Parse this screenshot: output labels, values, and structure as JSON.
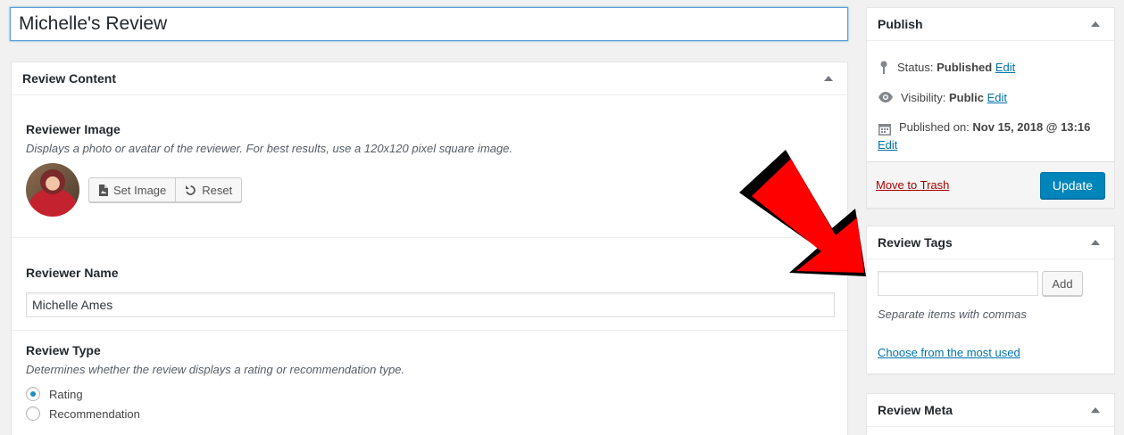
{
  "title": {
    "value": "Michelle's Review"
  },
  "review_content": {
    "heading": "Review Content",
    "reviewer_image": {
      "label": "Reviewer Image",
      "description": "Displays a photo or avatar of the reviewer. For best results, use a 120x120 pixel square image.",
      "set_image_label": "Set Image",
      "reset_label": "Reset"
    },
    "reviewer_name": {
      "label": "Reviewer Name",
      "value": "Michelle Ames"
    },
    "review_type": {
      "label": "Review Type",
      "description": "Determines whether the review displays a rating or recommendation type.",
      "options": [
        "Rating",
        "Recommendation"
      ],
      "selected": "Rating"
    }
  },
  "publish": {
    "heading": "Publish",
    "status_label": "Status:",
    "status_value": "Published",
    "visibility_label": "Visibility:",
    "visibility_value": "Public",
    "published_label": "Published on:",
    "published_value": "Nov 15, 2018 @ 13:16",
    "edit_label": "Edit",
    "trash_label": "Move to Trash",
    "update_label": "Update"
  },
  "review_tags": {
    "heading": "Review Tags",
    "input_value": "",
    "add_label": "Add",
    "hint": "Separate items with commas",
    "choose_label": "Choose from the most used"
  },
  "review_meta": {
    "heading": "Review Meta"
  },
  "colors": {
    "accent": "#0085ba",
    "link": "#0073aa",
    "trash": "#aa0000",
    "annotation_arrow": "#ff0000"
  },
  "icons": [
    "pin-icon",
    "eye-icon",
    "calendar-icon",
    "image-file-icon",
    "undo-icon",
    "toggle-arrow-icon"
  ]
}
